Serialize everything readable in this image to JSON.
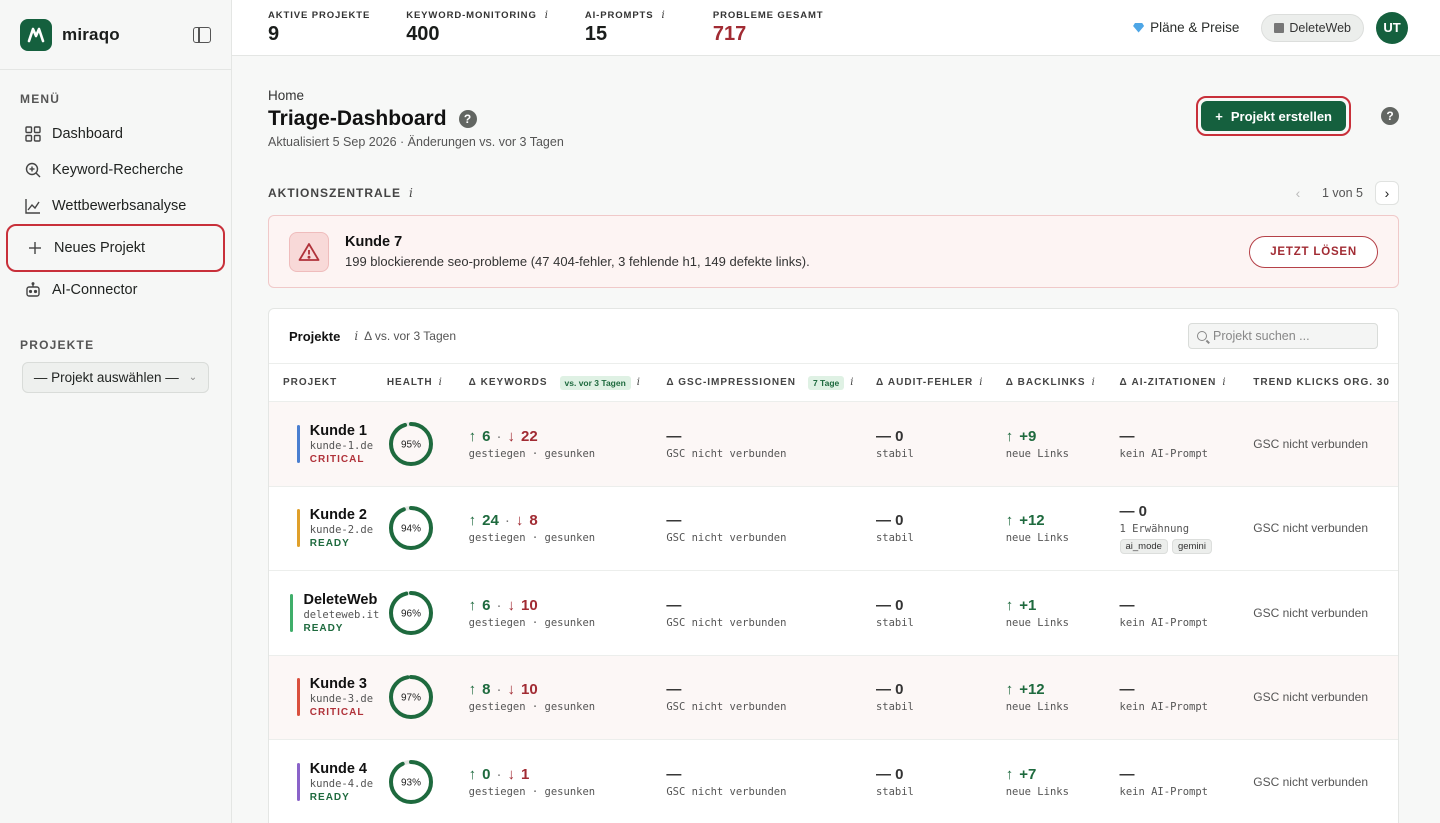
{
  "brand": {
    "name": "miraqo"
  },
  "sidebar": {
    "menu_label": "MENÜ",
    "items": [
      {
        "label": "Dashboard",
        "icon": "grid-icon"
      },
      {
        "label": "Keyword-Recherche",
        "icon": "search-plus-icon"
      },
      {
        "label": "Wettbewerbsanalyse",
        "icon": "line-chart-icon"
      },
      {
        "label": "Neues Projekt",
        "icon": "plus-icon"
      },
      {
        "label": "AI-Connector",
        "icon": "robot-icon"
      }
    ],
    "projects_label": "PROJEKTE",
    "project_select": "— Projekt auswählen —"
  },
  "topbar": {
    "stats": [
      {
        "label": "AKTIVE PROJEKTE",
        "value": "9",
        "info": false
      },
      {
        "label": "KEYWORD-MONITORING",
        "value": "400",
        "info": true
      },
      {
        "label": "AI-PROMPTS",
        "value": "15",
        "info": true
      },
      {
        "label": "PROBLEME GESAMT",
        "value": "717",
        "info": false
      }
    ],
    "plans_label": "Pläne & Preise",
    "account_label": "DeleteWeb",
    "avatar_initials": "UT"
  },
  "main": {
    "breadcrumb": "Home",
    "title": "Triage-Dashboard",
    "subtitle": "Aktualisiert 5 Sep 2026 · Änderungen vs. vor 3 Tagen",
    "create_button": "Projekt erstellen",
    "action_center_label": "AKTIONSZENTRALE",
    "pager_text": "1 von 5"
  },
  "alert": {
    "title": "Kunde 7",
    "text": "199 blockierende seo-probleme (47 404-fehler, 3 fehlende h1, 149 defekte links).",
    "button": "JETZT LÖSEN"
  },
  "table": {
    "title": "Projekte",
    "subtitle": "Δ vs. vor 3 Tagen",
    "search_placeholder": "Projekt suchen ...",
    "columns": {
      "projekt": "PROJEKT",
      "health": "HEALTH",
      "keywords": "Δ KEYWORDS",
      "keywords_chip": "vs. vor 3 Tagen",
      "gsc": "Δ GSC-IMPRESSIONEN",
      "gsc_chip": "7 Tage",
      "audit": "Δ AUDIT-FEHLER",
      "backlinks": "Δ BACKLINKS",
      "ai": "Δ AI-ZITATIONEN",
      "trend": "TREND KLICKS ORG. 30"
    },
    "rows": [
      {
        "name": "Kunde 1",
        "domain": "kunde-1.de",
        "status": "CRITICAL",
        "color": "#4a7fd0",
        "health": 95,
        "health_label": "95%",
        "kw_up": "6",
        "kw_down": "22",
        "kw_sub": "gestiegen · gesunken",
        "gsc_value": "—",
        "gsc_sub": "GSC nicht verbunden",
        "audit_value": "— 0",
        "audit_sub": "stabil",
        "bl_value": "+9",
        "bl_sub": "neue Links",
        "ai_value": "—",
        "ai_sub": "kein AI-Prompt",
        "ai_tags": [],
        "trend": "GSC nicht verbunden"
      },
      {
        "name": "Kunde 2",
        "domain": "kunde-2.de",
        "status": "READY",
        "color": "#e0a02a",
        "health": 94,
        "health_label": "94%",
        "kw_up": "24",
        "kw_down": "8",
        "kw_sub": "gestiegen · gesunken",
        "gsc_value": "—",
        "gsc_sub": "GSC nicht verbunden",
        "audit_value": "— 0",
        "audit_sub": "stabil",
        "bl_value": "+12",
        "bl_sub": "neue Links",
        "ai_value": "— 0",
        "ai_sub": "1 Erwähnung",
        "ai_tags": [
          "ai_mode",
          "gemini"
        ],
        "trend": "GSC nicht verbunden"
      },
      {
        "name": "DeleteWeb",
        "domain": "deleteweb.it",
        "status": "READY",
        "color": "#3fae6a",
        "health": 96,
        "health_label": "96%",
        "kw_up": "6",
        "kw_down": "10",
        "kw_sub": "gestiegen · gesunken",
        "gsc_value": "—",
        "gsc_sub": "GSC nicht verbunden",
        "audit_value": "— 0",
        "audit_sub": "stabil",
        "bl_value": "+1",
        "bl_sub": "neue Links",
        "ai_value": "—",
        "ai_sub": "kein AI-Prompt",
        "ai_tags": [],
        "trend": "GSC nicht verbunden"
      },
      {
        "name": "Kunde 3",
        "domain": "kunde-3.de",
        "status": "CRITICAL",
        "color": "#d9503e",
        "health": 97,
        "health_label": "97%",
        "kw_up": "8",
        "kw_down": "10",
        "kw_sub": "gestiegen · gesunken",
        "gsc_value": "—",
        "gsc_sub": "GSC nicht verbunden",
        "audit_value": "— 0",
        "audit_sub": "stabil",
        "bl_value": "+12",
        "bl_sub": "neue Links",
        "ai_value": "—",
        "ai_sub": "kein AI-Prompt",
        "ai_tags": [],
        "trend": "GSC nicht verbunden"
      },
      {
        "name": "Kunde 4",
        "domain": "kunde-4.de",
        "status": "READY",
        "color": "#8a63c9",
        "health": 93,
        "health_label": "93%",
        "kw_up": "0",
        "kw_down": "1",
        "kw_sub": "gestiegen · gesunken",
        "gsc_value": "—",
        "gsc_sub": "GSC nicht verbunden",
        "audit_value": "— 0",
        "audit_sub": "stabil",
        "bl_value": "+7",
        "bl_sub": "neue Links",
        "ai_value": "—",
        "ai_sub": "kein AI-Prompt",
        "ai_tags": [],
        "trend": "GSC nicht verbunden"
      }
    ]
  },
  "colors": {
    "brand": "#15603e",
    "danger": "#a12b33",
    "highlight_ring": "#c8303a"
  }
}
